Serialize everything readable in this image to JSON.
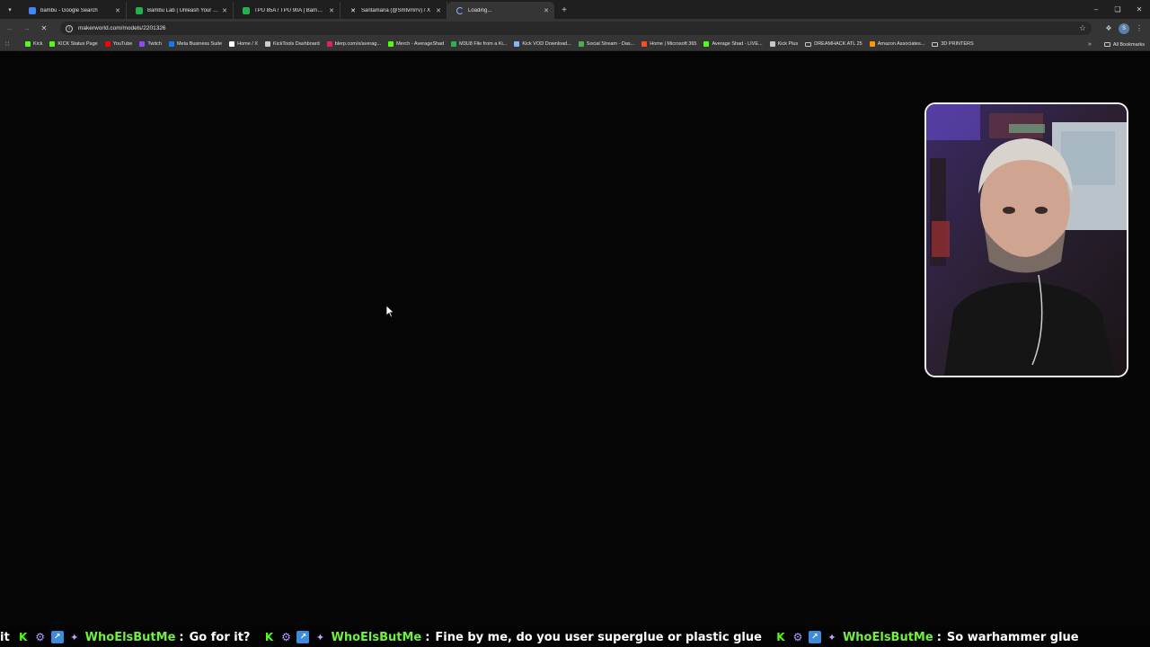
{
  "browser": {
    "tabs": [
      {
        "title": "bambu - Google Search",
        "favicon": "google-icon",
        "color": "#4285f4",
        "active": false
      },
      {
        "title": "Bambu Lab | Unleash Your Cre...",
        "favicon": "bambu-icon",
        "color": "#22b14c",
        "active": false
      },
      {
        "title": "TPU 85A / TPU 90A | Bambu La...",
        "favicon": "bambu-icon",
        "color": "#22b14c",
        "active": false
      },
      {
        "title": "Santamaria (@Smtvmrrv) / X",
        "favicon": "x-icon",
        "color": "#ffffff",
        "active": false
      },
      {
        "title": "Loading...",
        "favicon": "spinner-icon",
        "color": "#8ab4f8",
        "active": true
      }
    ],
    "address": "makerworld.com/models/2201326",
    "bookmarks": [
      {
        "label": "Kick",
        "color": "#53fc18"
      },
      {
        "label": "KICK Status Page",
        "color": "#53fc18"
      },
      {
        "label": "YouTube",
        "color": "#ff0000"
      },
      {
        "label": "Twitch",
        "color": "#9146ff"
      },
      {
        "label": "Meta Business Suite",
        "color": "#1877f2"
      },
      {
        "label": "Home / X",
        "color": "#ffffff"
      },
      {
        "label": "KickTools Dashboard",
        "color": "#cccccc"
      },
      {
        "label": "blerp.com/x/averag...",
        "color": "#e0245e"
      },
      {
        "label": "Merch - AverageShad",
        "color": "#53fc18"
      },
      {
        "label": "M3U8 File from a Ki...",
        "color": "#2fb24c"
      },
      {
        "label": "Kick VOD Download...",
        "color": "#8ab4f8"
      },
      {
        "label": "Social Stream - Das...",
        "color": "#4caf50"
      },
      {
        "label": "Home | Microsoft 365",
        "color": "#f25022"
      },
      {
        "label": "Average Shad - LIVE...",
        "color": "#53fc18"
      },
      {
        "label": "Kick Plus",
        "color": "#c4c7c5"
      },
      {
        "label": "DREAMHACK ATL 25",
        "color": "folder"
      },
      {
        "label": "Amazon Associates...",
        "color": "#ff9900"
      },
      {
        "label": "3D PRINTERS",
        "color": "folder"
      }
    ],
    "all_bookmarks": "All Bookmarks"
  },
  "chat": {
    "leading_fragment": "it",
    "messages": [
      {
        "user": "WhoElsButMe",
        "text": "Go for it?"
      },
      {
        "user": "WhoElsButMe",
        "text": "Fine by me, do you user superglue or plastic glue"
      },
      {
        "user": "WhoElsButMe",
        "text": "So warhammer glue"
      }
    ],
    "user_color": "#6ff03f"
  },
  "webcam": {
    "description_icon": "streamer-webcam"
  }
}
